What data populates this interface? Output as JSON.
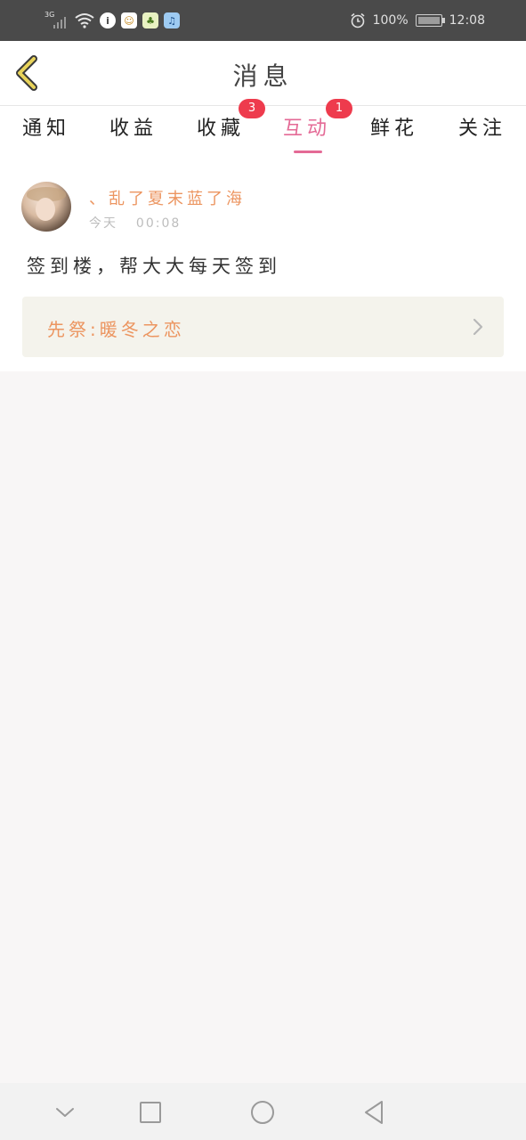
{
  "status_bar": {
    "network": "3G",
    "battery": "100%",
    "time": "12:08",
    "icons": [
      "signal-icon",
      "wifi-icon",
      "info-icon",
      "app-icon-1",
      "app-icon-2",
      "music-icon",
      "alarm-icon",
      "battery-icon"
    ]
  },
  "header": {
    "title": "消息",
    "back_icon": "chevron-left-icon"
  },
  "tabs": [
    {
      "label": "通知",
      "badge": "",
      "active": false
    },
    {
      "label": "收益",
      "badge": "",
      "active": false
    },
    {
      "label": "收藏",
      "badge": "3",
      "active": false
    },
    {
      "label": "互动",
      "badge": "1",
      "active": true
    },
    {
      "label": "鲜花",
      "badge": "",
      "active": false
    },
    {
      "label": "关注",
      "badge": "",
      "active": false
    }
  ],
  "message": {
    "username": "、乱了夏末蓝了海",
    "date": "今天",
    "time": "00:08",
    "text": "签到楼，帮大大每天签到",
    "ref": {
      "title": "先祭:暖冬之恋"
    }
  },
  "colors": {
    "accent_pink": "#e46a96",
    "orange_text": "#ec9560",
    "badge_red": "#ee3b4d",
    "status_bar": "#4a4a4a"
  },
  "nav": {
    "buttons": [
      "collapse-icon",
      "recents-icon",
      "home-icon",
      "back-icon"
    ]
  }
}
